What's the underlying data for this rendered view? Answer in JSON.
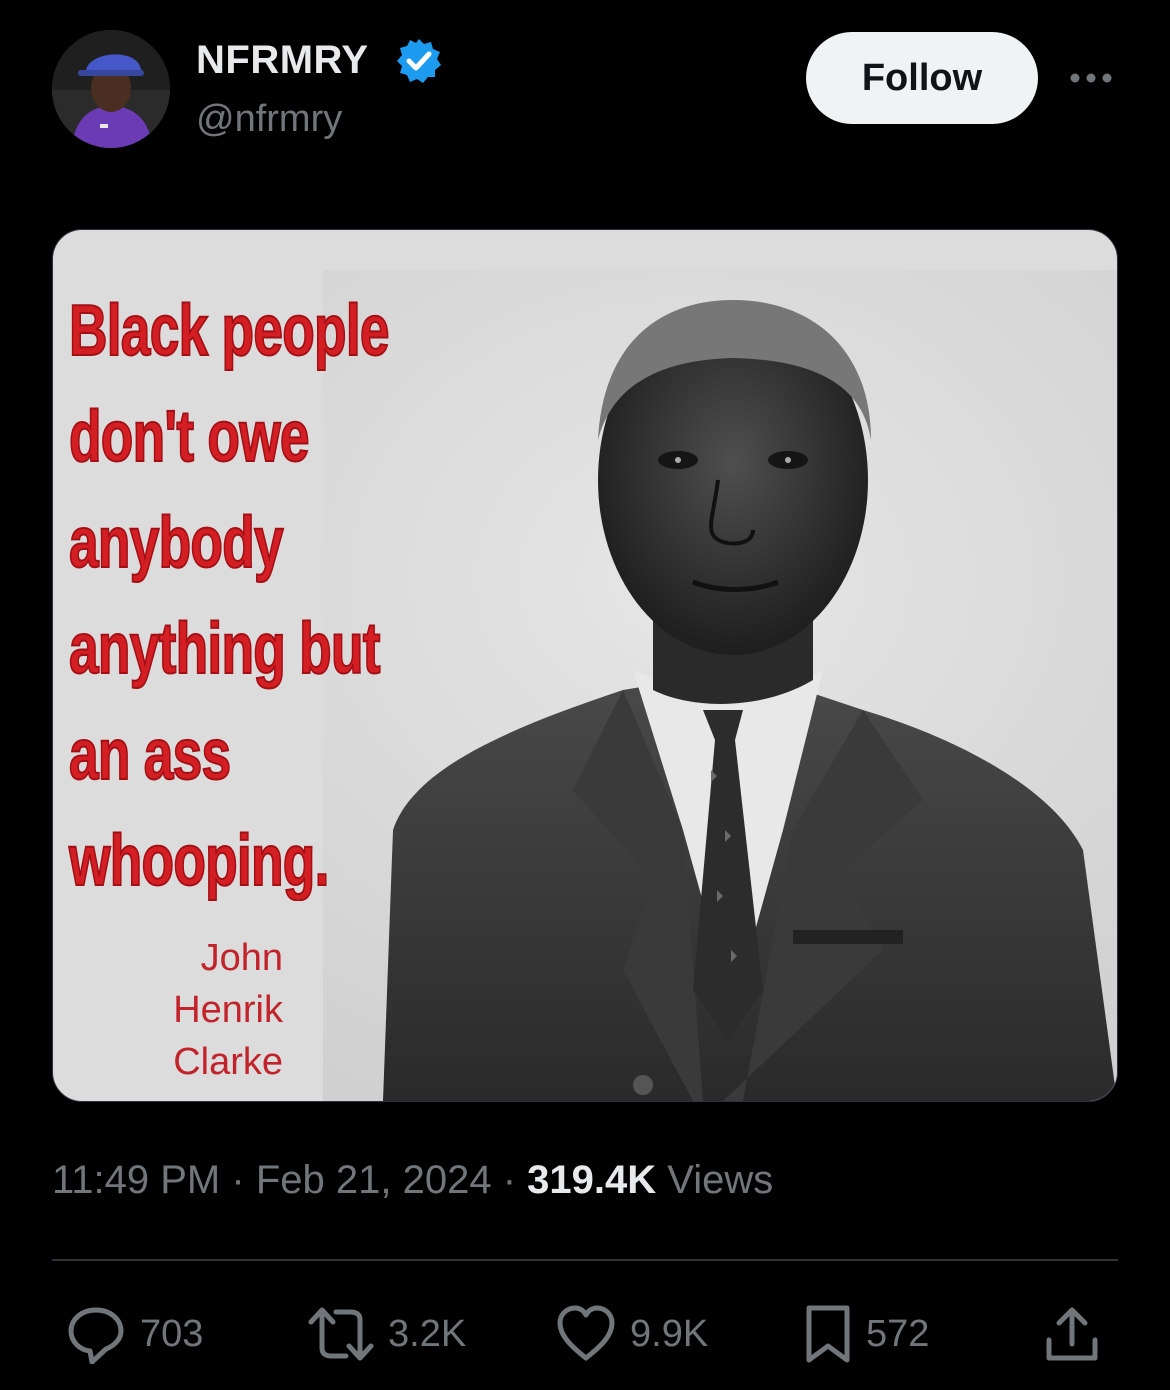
{
  "user": {
    "display_name": "NFRMRY",
    "handle": "@nfrmry",
    "verified_icon": "verified-badge-icon",
    "follow_label": "Follow"
  },
  "media": {
    "quote_lines": [
      "Black people",
      "don't owe",
      "anybody",
      "anything but",
      "an ass",
      "whooping."
    ],
    "attribution_lines": [
      "John",
      "Henrik",
      "Clarke"
    ]
  },
  "meta": {
    "time": "11:49 PM",
    "date": "Feb 21, 2024",
    "views_count": "319.4K",
    "views_label": "Views",
    "separator": "·"
  },
  "actions": {
    "replies": "703",
    "reposts": "3.2K",
    "likes": "9.9K",
    "bookmarks": "572"
  },
  "colors": {
    "background": "#000000",
    "quote_red": "#d31f24",
    "verified_blue": "#1d9bf0"
  }
}
